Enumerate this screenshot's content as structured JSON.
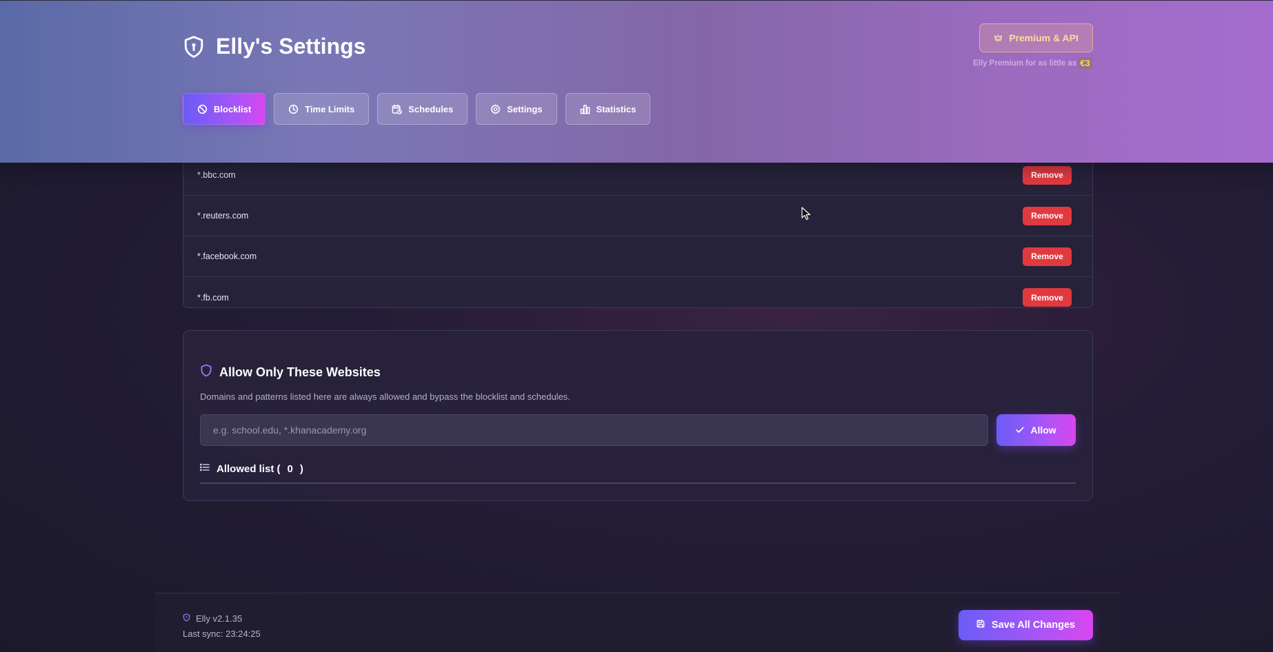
{
  "header": {
    "title": "Elly's Settings",
    "premium_button": "Premium & API",
    "premium_note": "Elly Premium for as little as",
    "premium_price": "€3"
  },
  "tabs": [
    {
      "label": "Blocklist",
      "icon": "ban-icon",
      "active": true
    },
    {
      "label": "Time Limits",
      "icon": "clock-icon",
      "active": false
    },
    {
      "label": "Schedules",
      "icon": "calendar-icon",
      "active": false
    },
    {
      "label": "Settings",
      "icon": "gear-icon",
      "active": false
    },
    {
      "label": "Statistics",
      "icon": "bar-chart-icon",
      "active": false
    }
  ],
  "blocklist": {
    "rows": [
      {
        "domain": "*.bbc.com",
        "action": "Remove"
      },
      {
        "domain": "*.reuters.com",
        "action": "Remove"
      },
      {
        "domain": "*.facebook.com",
        "action": "Remove"
      },
      {
        "domain": "*.fb.com",
        "action": "Remove"
      }
    ]
  },
  "allow": {
    "title": "Allow Only These Websites",
    "description": "Domains and patterns listed here are always allowed and bypass the blocklist and schedules.",
    "placeholder": "e.g. school.edu, *.khanacademy.org",
    "value": "",
    "button": "Allow",
    "list_label": "Allowed list (",
    "list_count": "0",
    "list_close": ")"
  },
  "footer": {
    "version": "Elly v2.1.35",
    "last_sync": "Last sync: 23:24:25",
    "save_button": "Save All Changes"
  },
  "colors": {
    "accent_start": "#6b5cf6",
    "accent_end": "#d946ef",
    "danger": "#e0393f",
    "price": "#ffd84a"
  }
}
